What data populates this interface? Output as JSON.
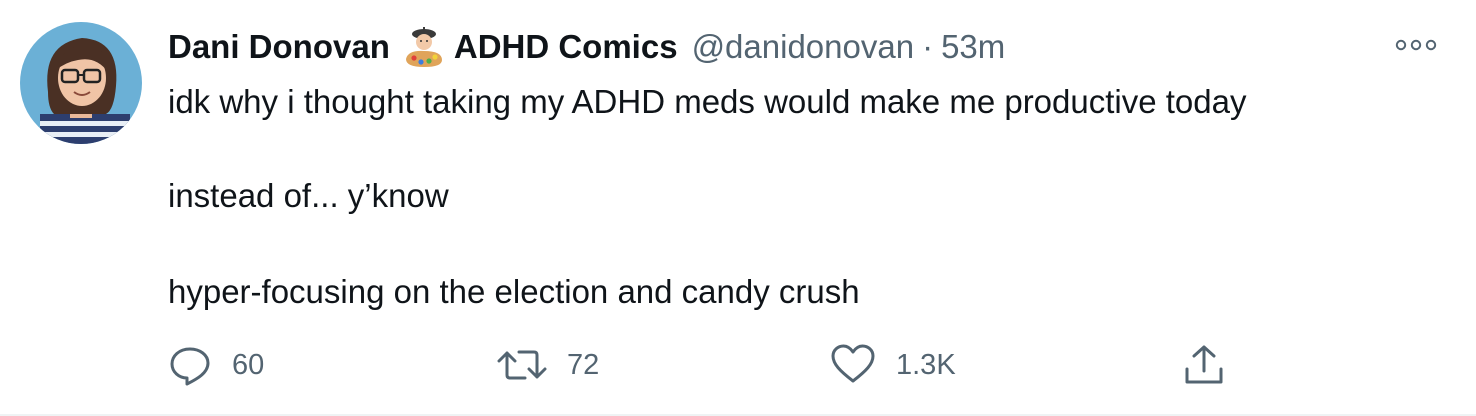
{
  "tweet": {
    "author_name": "Dani Donovan",
    "author_name_suffix": "ADHD Comics",
    "handle": "@danidonovan",
    "separator": "·",
    "time": "53m",
    "text_lines": [
      "idk why i thought taking my ADHD meds would make me productive today",
      "instead of... y’know",
      "hyper-focusing on the election and candy crush"
    ],
    "actions": {
      "reply_count": "60",
      "retweet_count": "72",
      "like_count": "1.3K"
    },
    "icons": {
      "avatar": "profile-avatar",
      "name_emoji": "artist-emoji",
      "more": "more-options-icon",
      "reply": "reply-icon",
      "retweet": "retweet-icon",
      "like": "heart-icon",
      "share": "share-icon"
    },
    "colors": {
      "text_primary": "#0f1419",
      "text_secondary": "#536471",
      "avatar_bg": "#6bb0d6"
    }
  }
}
